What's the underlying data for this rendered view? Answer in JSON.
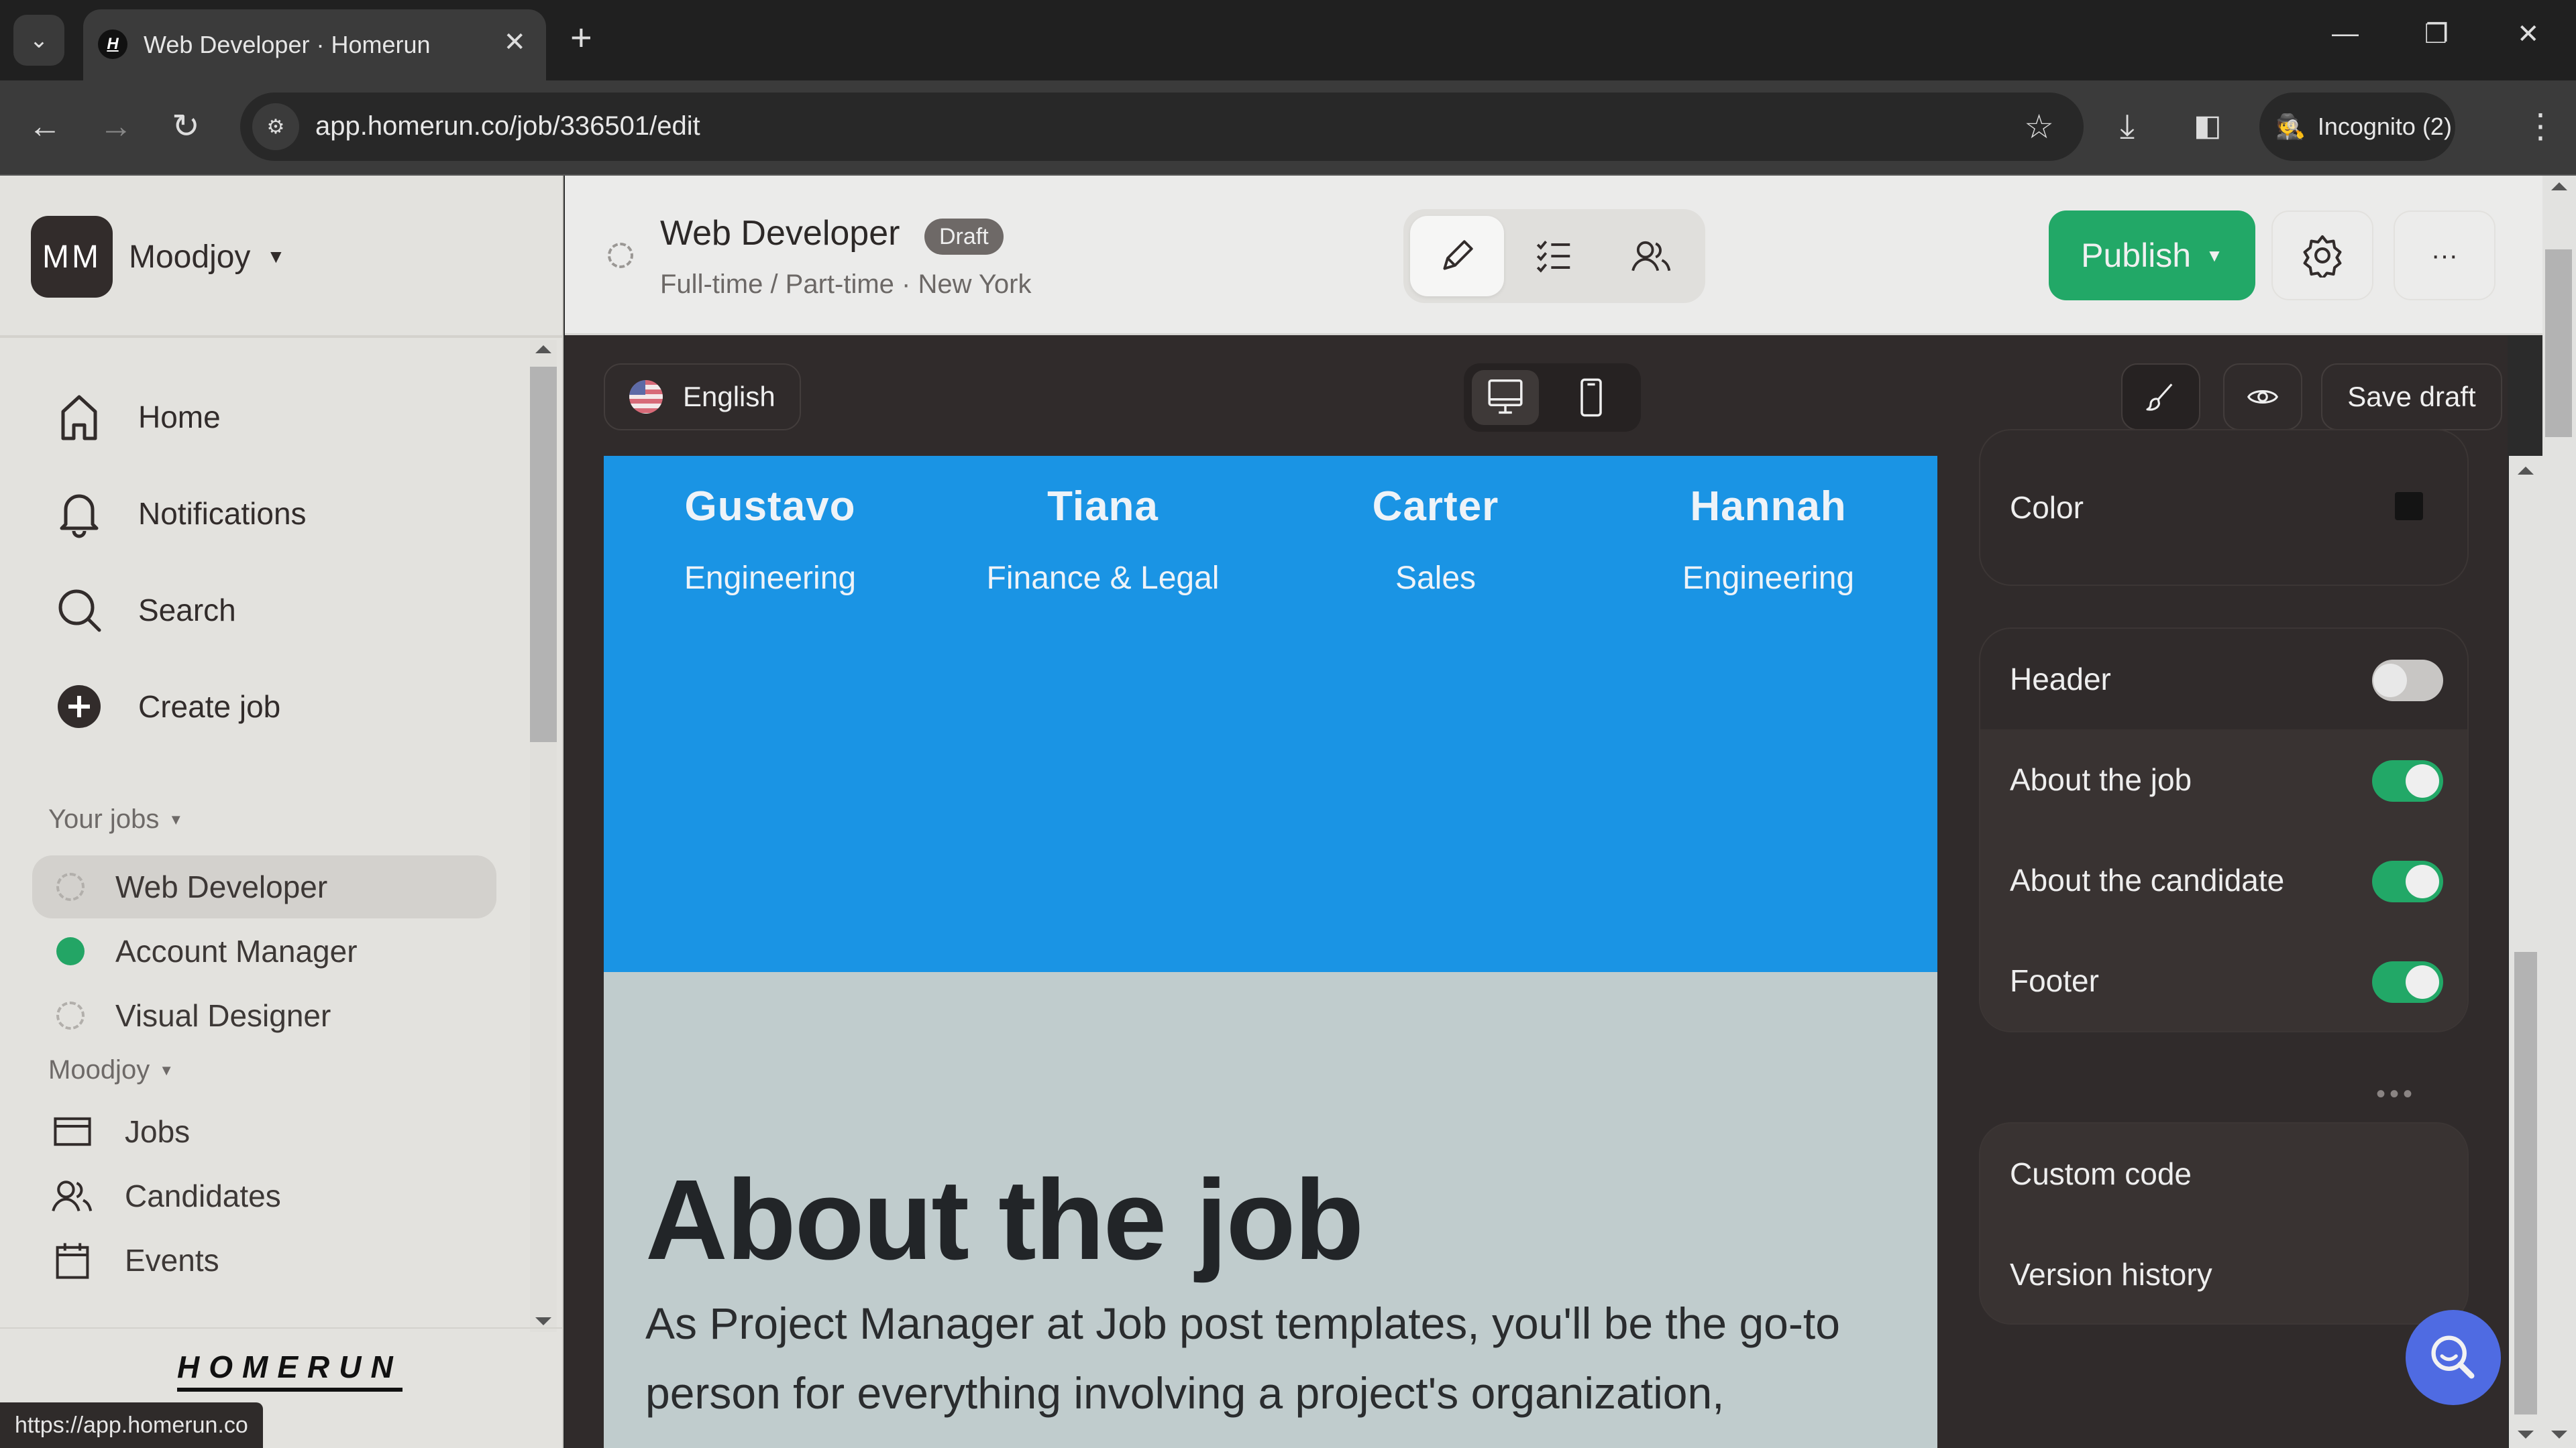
{
  "browser": {
    "tab_title": "Web Developer · Homerun",
    "url": "app.homerun.co/job/336501/edit",
    "incognito_label": "Incognito (2)",
    "status_url": "https://app.homerun.co"
  },
  "sidebar": {
    "org_initials": "MM",
    "org_name": "Moodjoy",
    "nav": [
      {
        "label": "Home",
        "icon": "home-icon"
      },
      {
        "label": "Notifications",
        "icon": "bell-icon"
      },
      {
        "label": "Search",
        "icon": "search-icon"
      },
      {
        "label": "Create job",
        "icon": "plus-circle-icon"
      }
    ],
    "your_jobs_label": "Your jobs",
    "jobs": [
      {
        "label": "Web Developer",
        "status": "draft",
        "active": true
      },
      {
        "label": "Account Manager",
        "status": "published",
        "active": false
      },
      {
        "label": "Visual Designer",
        "status": "draft",
        "active": false
      }
    ],
    "workspace_label": "Moodjoy",
    "workspace_items": [
      {
        "label": "Jobs",
        "icon": "jobs-icon"
      },
      {
        "label": "Candidates",
        "icon": "candidates-icon"
      },
      {
        "label": "Events",
        "icon": "calendar-icon"
      }
    ],
    "logo_text": "HOMERUN"
  },
  "header": {
    "job_title": "Web Developer",
    "status_badge": "Draft",
    "job_meta": "Full-time / Part-time · New York",
    "publish_label": "Publish",
    "colors": {
      "publish": "#22a867"
    }
  },
  "toolbar": {
    "language": "English",
    "save_draft_label": "Save draft"
  },
  "preview": {
    "team": [
      {
        "name": "Gustavo",
        "department": "Engineering"
      },
      {
        "name": "Tiana",
        "department": "Finance & Legal"
      },
      {
        "name": "Carter",
        "department": "Sales"
      },
      {
        "name": "Hannah",
        "department": "Engineering"
      }
    ],
    "about_title": "About the job",
    "about_text": "As Project Manager at Job post templates, you'll be the go-to person for everything involving a project's organization,",
    "colors": {
      "team_bg": "#1a94e4",
      "about_bg": "#c0cccd"
    }
  },
  "settings": {
    "color_label": "Color",
    "color_value": "#141414",
    "sections": [
      {
        "label": "Header",
        "enabled": false
      },
      {
        "label": "About the job",
        "enabled": true
      },
      {
        "label": "About the candidate",
        "enabled": true
      },
      {
        "label": "Footer",
        "enabled": true
      }
    ],
    "more_label": "•••",
    "links": [
      {
        "label": "Custom code"
      },
      {
        "label": "Version history"
      }
    ]
  }
}
